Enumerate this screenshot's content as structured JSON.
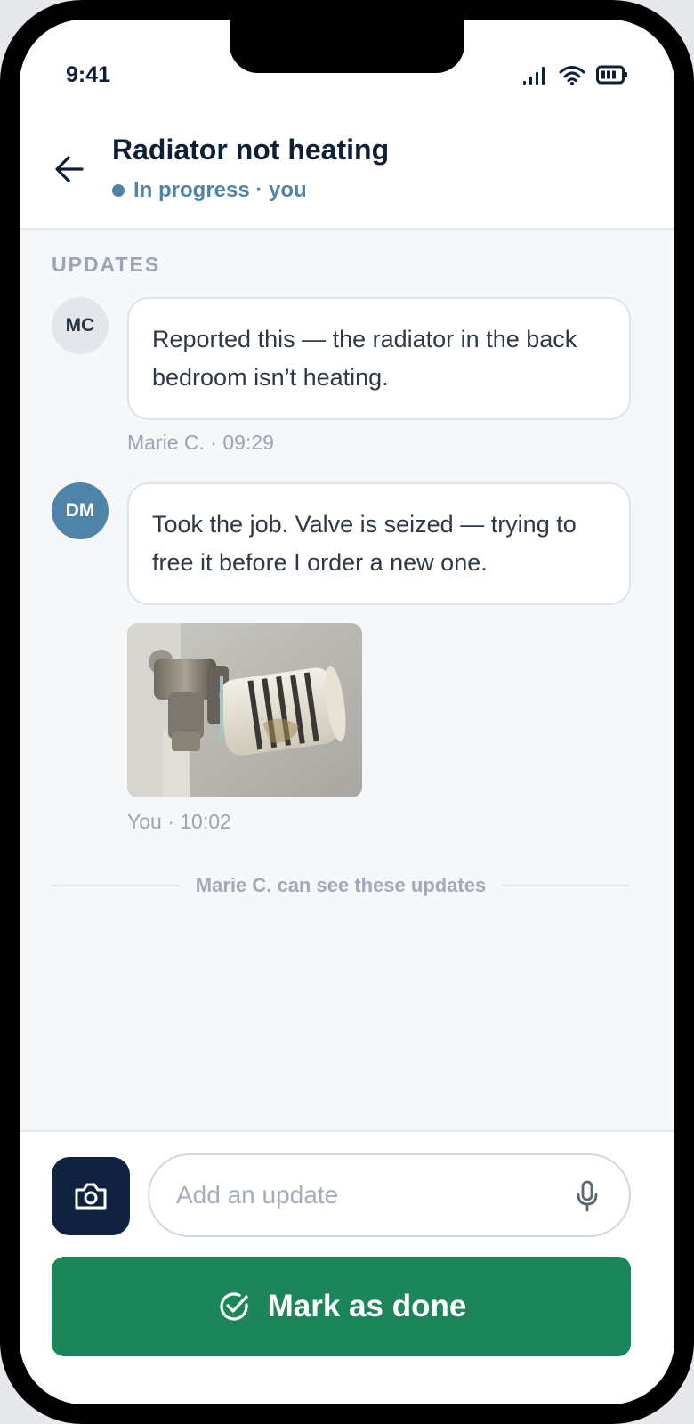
{
  "status_bar": {
    "time": "9:41",
    "icons": [
      "signal-icon",
      "wifi-icon",
      "battery-icon"
    ]
  },
  "header": {
    "title": "Radiator not heating",
    "status": "In progress · you",
    "status_color": "#4f84a8",
    "back_icon": "arrow-left-icon"
  },
  "updates": {
    "section_label": "UPDATES",
    "messages": [
      {
        "initials": "MC",
        "text": "Reported this — the radiator in the back bedroom isn’t heating.",
        "meta": "Marie C. · 09:29"
      },
      {
        "initials": "DM",
        "text": "Took the job. Valve is seized — trying to free it before I order a new one.",
        "attachment": "radiator-valve-photo",
        "meta": "You · 10:02"
      }
    ],
    "visibility_note": "Marie C. can see these updates"
  },
  "composer": {
    "camera_icon": "camera-icon",
    "placeholder": "Add an update",
    "mic_icon": "microphone-icon",
    "done_label": "Mark as done",
    "done_icon": "check-circle-icon",
    "done_color": "#1c855a"
  }
}
